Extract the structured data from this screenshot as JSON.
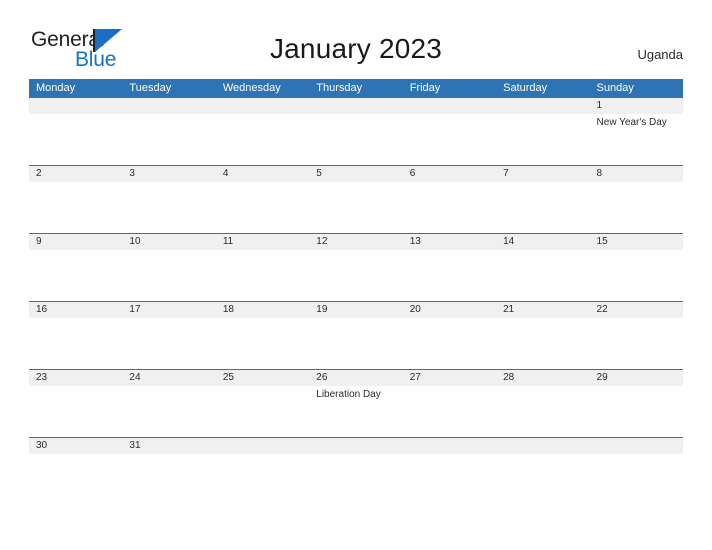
{
  "brand": {
    "name_part1": "General",
    "name_part2": "Blue",
    "mark": "sail-triangle"
  },
  "header": {
    "title": "January 2023",
    "region": "Uganda"
  },
  "calendar": {
    "weekdays": [
      "Monday",
      "Tuesday",
      "Wednesday",
      "Thursday",
      "Friday",
      "Saturday",
      "Sunday"
    ],
    "colors": {
      "header_blue": "#2e74b5",
      "date_band_gray": "#f0f0f0",
      "text_dark": "#2b2b2b",
      "brand_blue": "#1274c4"
    },
    "weeks": [
      {
        "days": [
          {
            "date": "",
            "event": ""
          },
          {
            "date": "",
            "event": ""
          },
          {
            "date": "",
            "event": ""
          },
          {
            "date": "",
            "event": ""
          },
          {
            "date": "",
            "event": ""
          },
          {
            "date": "",
            "event": ""
          },
          {
            "date": "1",
            "event": "New Year's Day"
          }
        ]
      },
      {
        "days": [
          {
            "date": "2",
            "event": ""
          },
          {
            "date": "3",
            "event": ""
          },
          {
            "date": "4",
            "event": ""
          },
          {
            "date": "5",
            "event": ""
          },
          {
            "date": "6",
            "event": ""
          },
          {
            "date": "7",
            "event": ""
          },
          {
            "date": "8",
            "event": ""
          }
        ]
      },
      {
        "days": [
          {
            "date": "9",
            "event": ""
          },
          {
            "date": "10",
            "event": ""
          },
          {
            "date": "11",
            "event": ""
          },
          {
            "date": "12",
            "event": ""
          },
          {
            "date": "13",
            "event": ""
          },
          {
            "date": "14",
            "event": ""
          },
          {
            "date": "15",
            "event": ""
          }
        ]
      },
      {
        "days": [
          {
            "date": "16",
            "event": ""
          },
          {
            "date": "17",
            "event": ""
          },
          {
            "date": "18",
            "event": ""
          },
          {
            "date": "19",
            "event": ""
          },
          {
            "date": "20",
            "event": ""
          },
          {
            "date": "21",
            "event": ""
          },
          {
            "date": "22",
            "event": ""
          }
        ]
      },
      {
        "days": [
          {
            "date": "23",
            "event": ""
          },
          {
            "date": "24",
            "event": ""
          },
          {
            "date": "25",
            "event": ""
          },
          {
            "date": "26",
            "event": "Liberation Day"
          },
          {
            "date": "27",
            "event": ""
          },
          {
            "date": "28",
            "event": ""
          },
          {
            "date": "29",
            "event": ""
          }
        ]
      },
      {
        "days": [
          {
            "date": "30",
            "event": ""
          },
          {
            "date": "31",
            "event": ""
          },
          {
            "date": "",
            "event": ""
          },
          {
            "date": "",
            "event": ""
          },
          {
            "date": "",
            "event": ""
          },
          {
            "date": "",
            "event": ""
          },
          {
            "date": "",
            "event": ""
          }
        ]
      }
    ]
  }
}
